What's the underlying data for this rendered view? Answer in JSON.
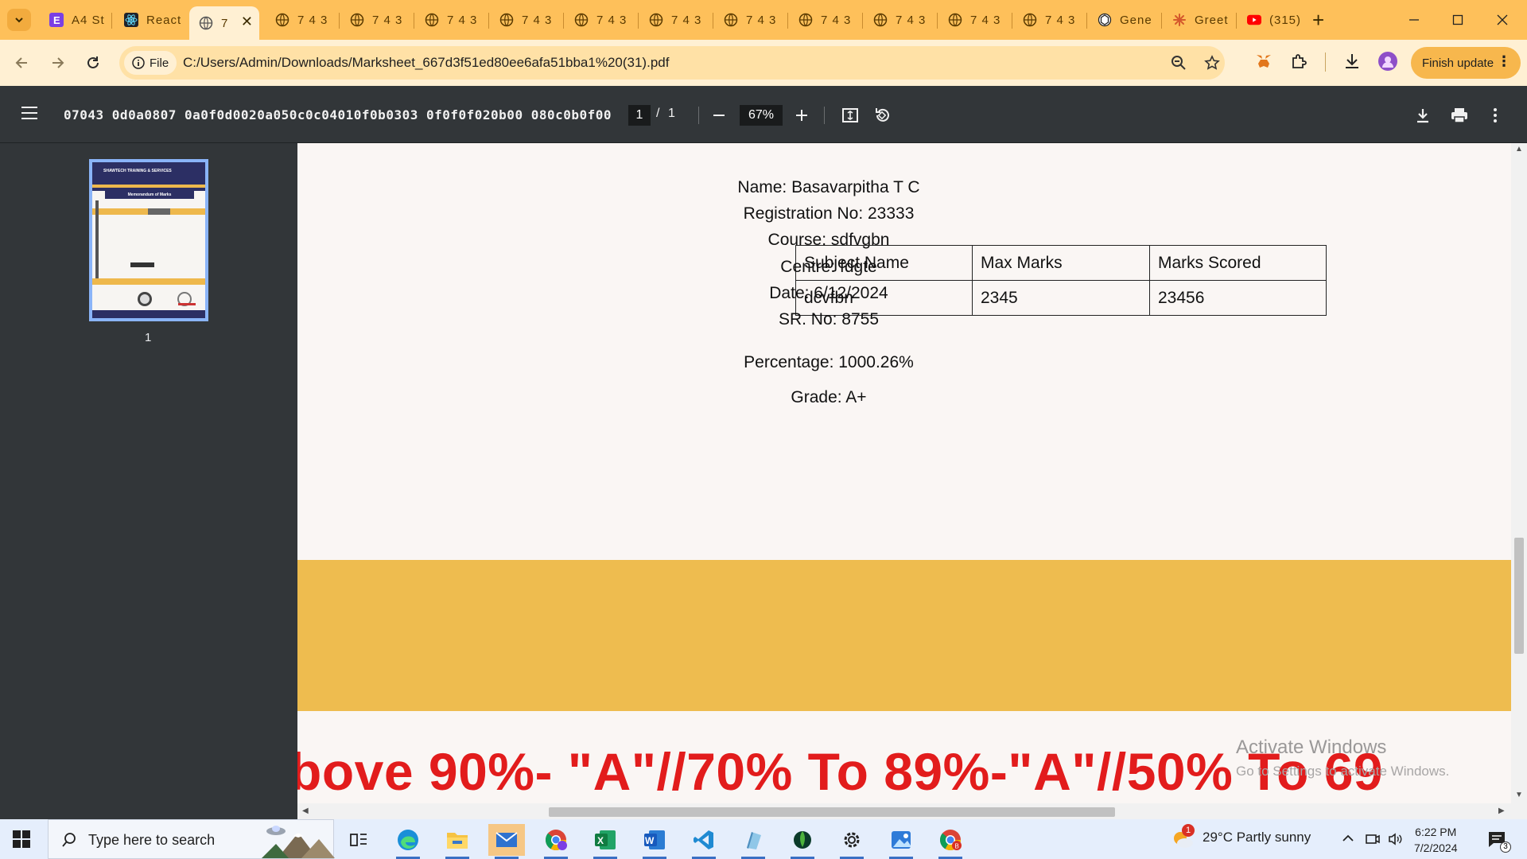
{
  "browser": {
    "tabs": [
      {
        "title": "A4 St",
        "favicon": "purple-e-icon"
      },
      {
        "title": "React",
        "favicon": "react-icon"
      },
      {
        "title": "7",
        "favicon": "globe-icon",
        "active": true
      },
      {
        "title": "7 4 3",
        "favicon": "globe-icon"
      },
      {
        "title": "7 4 3",
        "favicon": "globe-icon"
      },
      {
        "title": "7 4 3",
        "favicon": "globe-icon"
      },
      {
        "title": "7 4 3",
        "favicon": "globe-icon"
      },
      {
        "title": "7 4 3",
        "favicon": "globe-icon"
      },
      {
        "title": "7 4 3",
        "favicon": "globe-icon"
      },
      {
        "title": "7 4 3",
        "favicon": "globe-icon"
      },
      {
        "title": "7 4 3",
        "favicon": "globe-icon"
      },
      {
        "title": "7 4 3",
        "favicon": "globe-icon"
      },
      {
        "title": "7 4 3",
        "favicon": "globe-icon"
      },
      {
        "title": "7 4 3",
        "favicon": "globe-icon"
      },
      {
        "title": "Gene",
        "favicon": "openai-icon"
      },
      {
        "title": "Greet",
        "favicon": "claude-icon"
      },
      {
        "title": "(315)",
        "favicon": "youtube-icon"
      }
    ],
    "site_chip": "File",
    "url": "C:/Users/Admin/Downloads/Marksheet_667d3f51ed80ee6afa51bba1%20(31).pdf",
    "finish_update": "Finish update"
  },
  "pdf_toolbar": {
    "title": "07043 0d0a0807 0a0f0d0020a050c0c04010f0b0303 0f0f0f020b00 080c0b0f00",
    "page_current": "1",
    "page_sep": "/",
    "page_total": "1",
    "zoom": "67%"
  },
  "sidebar": {
    "thumbnail_label": "1",
    "thumb_heading": "SHAWTECH TRAINING & SERVICES",
    "thumb_memo": "Memorandum of Marks"
  },
  "document": {
    "name": "Name: Basavarpitha T C",
    "registration": "Registration No: 23333",
    "course": "Course: sdfvgbn",
    "center": "Centre: fdgte",
    "date": "Date: 6/12/2024",
    "sr_no": "SR. No: 8755",
    "table": {
      "headers": [
        "Subject Name",
        "Max Marks",
        "Marks Scored"
      ],
      "rows": [
        [
          "dcvfbn",
          "2345",
          "23456"
        ]
      ]
    },
    "percentage": "Percentage: 1000.26%",
    "grade": "Grade: A+",
    "grade_scale": "bove 90%- \"A\"//70% To 89%-\"A\"//50% To 69"
  },
  "watermark": {
    "title": "Activate Windows",
    "subtitle": "Go to Settings to activate Windows."
  },
  "taskbar": {
    "search_placeholder": "Type here to search",
    "weather": "29°C  Partly sunny",
    "time": "6:22 PM",
    "date": "7/2/2024",
    "notifications": "3",
    "weather_badge": "1"
  },
  "colors": {
    "tab_strip": "#fec05a",
    "toolbar": "#fff0d3",
    "gold_band": "#eebc4f",
    "grade_text": "#e21c1c"
  }
}
